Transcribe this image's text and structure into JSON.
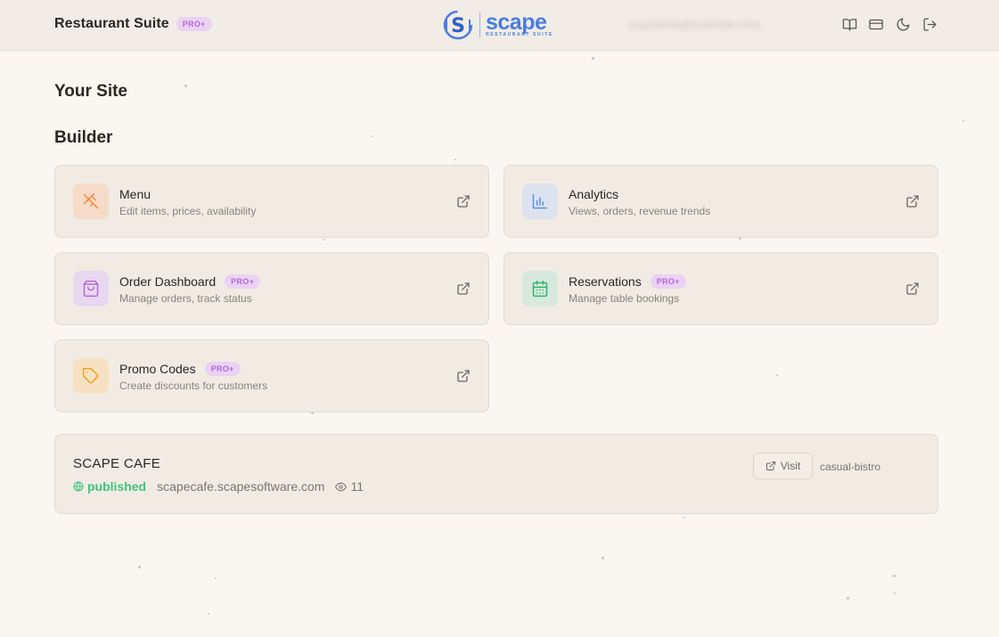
{
  "header": {
    "app_title": "Restaurant Suite",
    "plan_badge": "PRO+",
    "logo_word": "scape",
    "logo_sub": "RESTAURANT SUITE",
    "email_blurred": "yourname@example.com",
    "icons": [
      "book-icon",
      "card-icon",
      "moon-icon",
      "logout-icon"
    ]
  },
  "page": {
    "heading_site": "Your Site",
    "heading_builder": "Builder"
  },
  "cards": [
    {
      "title": "Menu",
      "desc": "Edit items, prices, availability",
      "badge": "",
      "icon": "utensils-icon",
      "color": "#f08a3e",
      "bg": "#f6dcc8"
    },
    {
      "title": "Analytics",
      "desc": "Views, orders, revenue trends",
      "badge": "",
      "icon": "bar-chart-icon",
      "color": "#5b8fe6",
      "bg": "#dde3ee"
    },
    {
      "title": "Order Dashboard",
      "desc": "Manage orders, track status",
      "badge": "PRO+",
      "icon": "shopping-bag-icon",
      "color": "#b26ad6",
      "bg": "#e8d8ef"
    },
    {
      "title": "Reservations",
      "desc": "Manage table bookings",
      "badge": "PRO+",
      "icon": "calendar-icon",
      "color": "#34b36e",
      "bg": "#d6e9dc"
    },
    {
      "title": "Promo Codes",
      "desc": "Create discounts for customers",
      "badge": "PRO+",
      "icon": "tag-icon",
      "color": "#f0a020",
      "bg": "#f6e2c2"
    }
  ],
  "site": {
    "name": "SCAPE CAFE",
    "status": "published",
    "domain": "scapecafe.scapesoftware.com",
    "views": "11",
    "visit_label": "Visit",
    "template": "casual-bistro"
  }
}
